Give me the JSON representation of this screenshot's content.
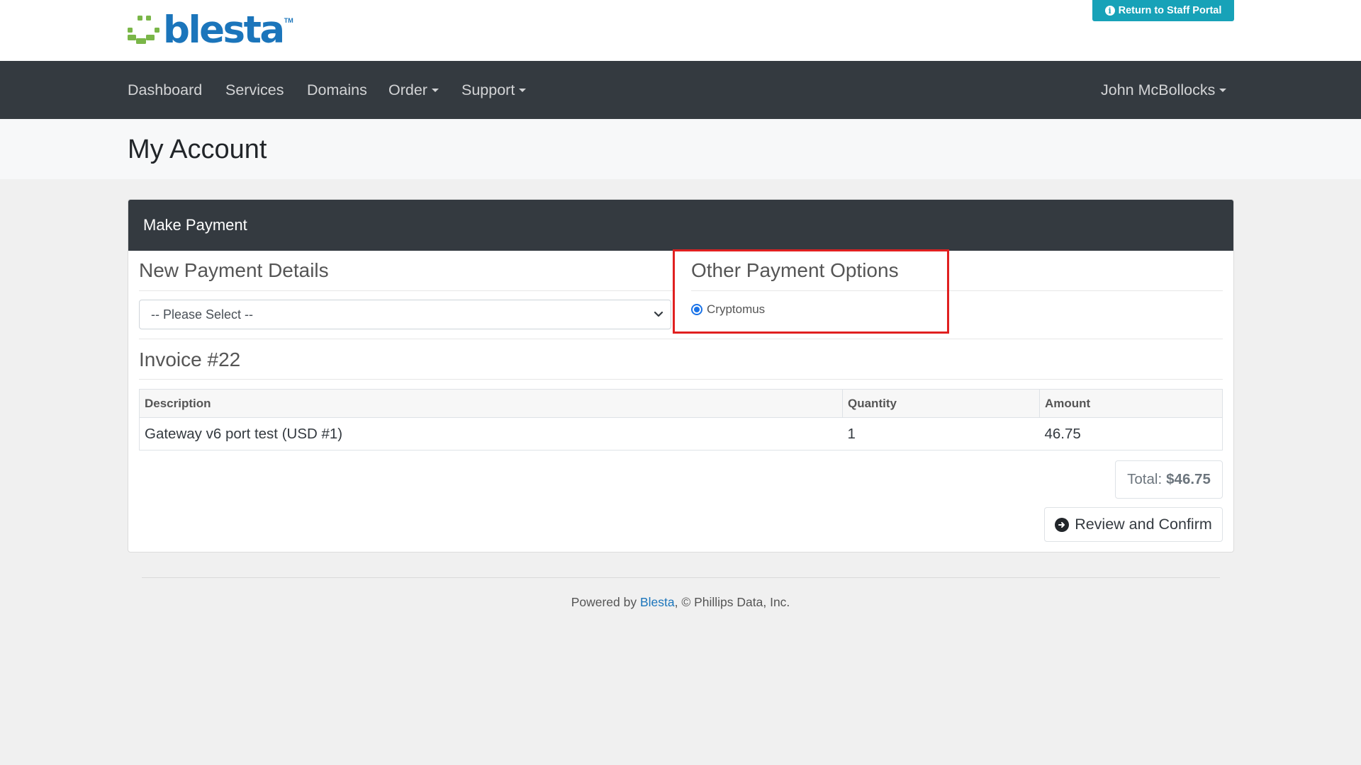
{
  "header": {
    "logo_text": "blesta",
    "logo_tm": "TM",
    "staff_portal_label": "Return to Staff Portal"
  },
  "nav": {
    "items": [
      {
        "label": "Dashboard"
      },
      {
        "label": "Services"
      },
      {
        "label": "Domains"
      },
      {
        "label": "Order"
      },
      {
        "label": "Support"
      }
    ],
    "user_menu": "John McBollocks"
  },
  "page": {
    "title": "My Account"
  },
  "card": {
    "header": "Make Payment",
    "new_payment": {
      "heading": "New Payment Details",
      "select_value": "-- Please Select --"
    },
    "other_options": {
      "heading": "Other Payment Options",
      "gateway_label": "Cryptomus",
      "gateway_selected": true
    },
    "invoice": {
      "heading": "Invoice #22",
      "columns": [
        "Description",
        "Quantity",
        "Amount"
      ],
      "rows": [
        {
          "description": "Gateway v6 port test (USD #1)",
          "quantity": "1",
          "amount": "46.75"
        }
      ],
      "total_label": "Total:",
      "total_value": "$46.75"
    },
    "review_button": "Review and Confirm"
  },
  "footer": {
    "prefix": "Powered by ",
    "link": "Blesta",
    "suffix": ", © Phillips Data, Inc."
  },
  "colors": {
    "brand_blue": "#1b75bb",
    "brand_green": "#7ab648",
    "navbar": "#343a40",
    "staff_button": "#17a2b8",
    "highlight": "#e02020"
  }
}
